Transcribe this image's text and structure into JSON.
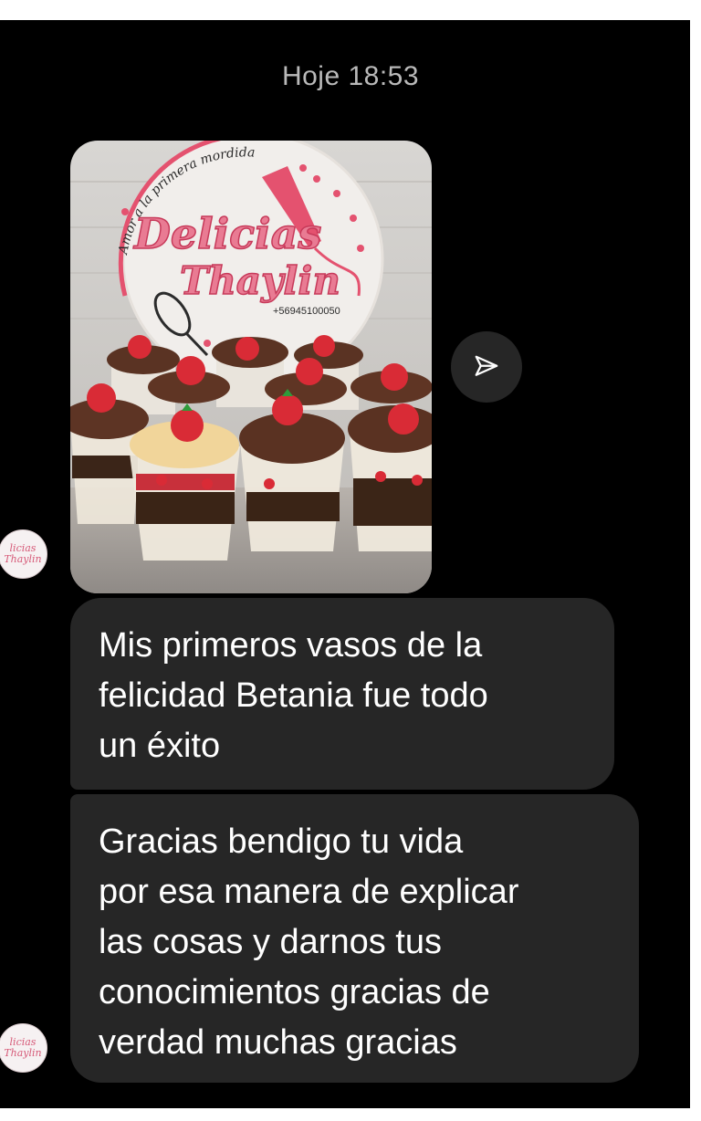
{
  "conversation": {
    "timestamp": "Hoje 18:53",
    "photo": {
      "sign_tagline": "Amor a la primera mordida",
      "sign_name_line1": "Delicias",
      "sign_name_line2": "Thaylin",
      "sign_phone": "+56945100050"
    },
    "share_icon": "send-arrow-icon",
    "messages": [
      {
        "text": "Mis primeros vasos de la\nfelicidad Betania fue todo\nun éxito"
      },
      {
        "text": "Gracias bendigo tu vida\npor esa manera de explicar\nlas cosas y darnos tus\nconocimientos gracias de\nverdad muchas gracias"
      }
    ],
    "avatar_text": {
      "line1": "licias",
      "line2": "Thaylin"
    }
  },
  "colors": {
    "background": "#000000",
    "bubble": "#262626",
    "timestamp": "#b9b9b9",
    "brand_pink": "#e4526f"
  }
}
